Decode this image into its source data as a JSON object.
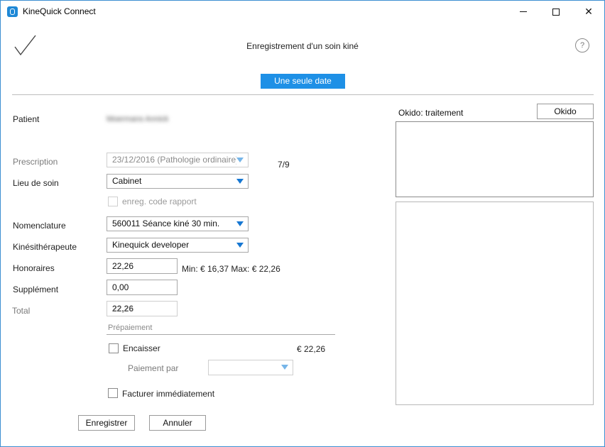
{
  "window": {
    "title": "KineQuick Connect",
    "accent_color": "#1e90e6"
  },
  "header": {
    "title": "Enregistrement d'un soin kiné",
    "confirm_icon": "checkmark-icon",
    "help_icon": "help-icon",
    "help_glyph": "?"
  },
  "tabs": {
    "single_date": "Une seule date"
  },
  "form": {
    "patient_label": "Patient",
    "patient_name": "Moermans Annick",
    "prescription_label": "Prescription",
    "prescription_value": "23/12/2016 (Pathologie ordinaire)",
    "prescription_counter": "7/9",
    "lieu_label": "Lieu de soin",
    "lieu_value": "Cabinet",
    "code_rapport_label": "enreg. code rapport",
    "nomenclature_label": "Nomenclature",
    "nomenclature_value": "560011 Séance kiné 30 min.",
    "kine_label": "Kinésithérapeute",
    "kine_value": "Kinequick developer",
    "honoraires_label": "Honoraires",
    "honoraires_value": "22,26",
    "honoraires_range": "Min: € 16,37 Max: € 22,26",
    "supplement_label": "Supplément",
    "supplement_value": "0,00",
    "total_label": "Total",
    "total_value": "22,26"
  },
  "prepayment": {
    "section_title": "Prépaiement",
    "encaisser_label": "Encaisser",
    "encaisser_amount": "€ 22,26",
    "paiement_par_label": "Paiement par",
    "paiement_par_value": "",
    "facturer_label": "Facturer immédiatement"
  },
  "buttons": {
    "save": "Enregistrer",
    "cancel": "Annuler"
  },
  "okido": {
    "label": "Okido: traitement",
    "button": "Okido"
  }
}
